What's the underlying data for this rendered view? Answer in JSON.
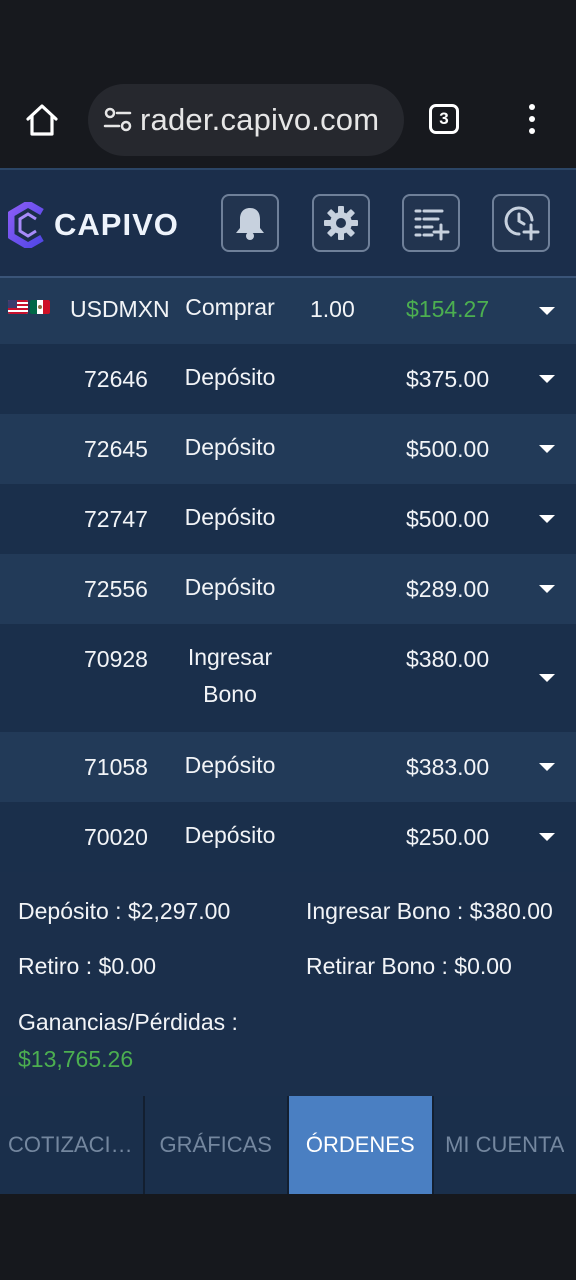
{
  "browser": {
    "url": "rader.capivo.com",
    "tab_count": "3"
  },
  "app": {
    "logo_text": "CAPIVO",
    "buttons": [
      "bell-icon",
      "gear-icon",
      "add-list-icon",
      "add-clock-icon"
    ]
  },
  "position": {
    "flags": [
      "us-flag",
      "mx-flag"
    ],
    "symbol": "USDMXN",
    "type": "Comprar",
    "volume": "1.00",
    "profit": "$154.27",
    "profit_color": "#4caf50"
  },
  "orders": [
    {
      "id": "72646",
      "type": "Depósito",
      "amount": "$375.00"
    },
    {
      "id": "72645",
      "type": "Depósito",
      "amount": "$500.00"
    },
    {
      "id": "72747",
      "type": "Depósito",
      "amount": "$500.00"
    },
    {
      "id": "72556",
      "type": "Depósito",
      "amount": "$289.00"
    },
    {
      "id": "70928",
      "type": "Ingresar Bono",
      "amount": "$380.00"
    },
    {
      "id": "71058",
      "type": "Depósito",
      "amount": "$383.00"
    },
    {
      "id": "70020",
      "type": "Depósito",
      "amount": "$250.00"
    }
  ],
  "summary": {
    "deposit": "Depósito : $2,297.00",
    "bonus_in": "Ingresar Bono : $380.00",
    "withdraw": "Retiro : $0.00",
    "bonus_out": "Retirar Bono : $0.00",
    "pl_label": "Ganancias/Pérdidas :",
    "pl_value": "$13,765.26"
  },
  "tabs": [
    {
      "label": "COTIZACIONES",
      "active": false
    },
    {
      "label": "GRÁFICAS",
      "active": false
    },
    {
      "label": "ÓRDENES",
      "active": true
    },
    {
      "label": "MI CUENTA",
      "active": false
    }
  ],
  "colors": {
    "accent": "#4a7fc2",
    "header_bg": "#1b2e4b",
    "positive": "#4caf50"
  }
}
